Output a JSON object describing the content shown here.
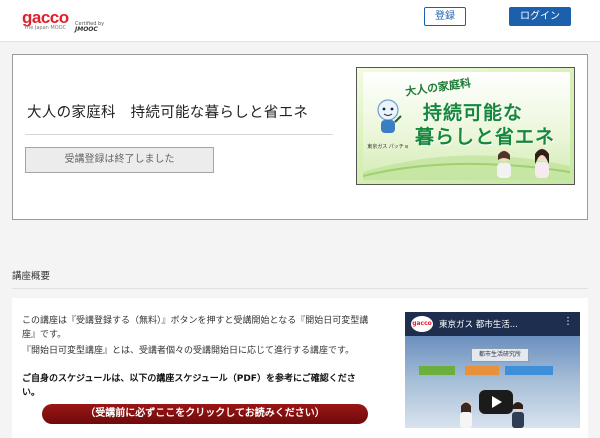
{
  "header": {
    "logo_main": "gacco",
    "logo_sub": "The Japan MOOC",
    "logo_cert": "Certified by",
    "logo_jmooc": "JMOOC",
    "register_label": "登録",
    "login_label": "ログイン"
  },
  "course": {
    "title": "大人の家庭科　持続可能な暮らしと省エネ",
    "closed_label": "受講登録は終了しました",
    "banner": {
      "subtitle": "大人の家庭科",
      "line1": "持続可能な",
      "line2": "暮らしと省エネ",
      "mascot_label": "東京ガス パッチョ"
    }
  },
  "overview": {
    "section_title": "講座概要",
    "para1": "この講座は『受講登録する（無料）』ボタンを押すと受講開始となる『開始日可変型講座』です。",
    "para2": "『開始日可変型講座』とは、受講者個々の受講開始日に応じて進行する講座です。",
    "para3": "ご自身のスケジュールは、以下の講座スケジュール（PDF）を参考にご確認ください。",
    "red_button_label": "（受講前に必ずここをクリックしてお読みください）"
  },
  "video": {
    "badge": "gacco",
    "title": "東京ガス 都市生活...",
    "dots": "⋮",
    "sign": "都市生活研究所"
  },
  "colors": {
    "brand_red": "#e0202a",
    "primary_blue": "#1a60ad",
    "banner_green": "#16883c",
    "cta_red": "#8a1010"
  }
}
